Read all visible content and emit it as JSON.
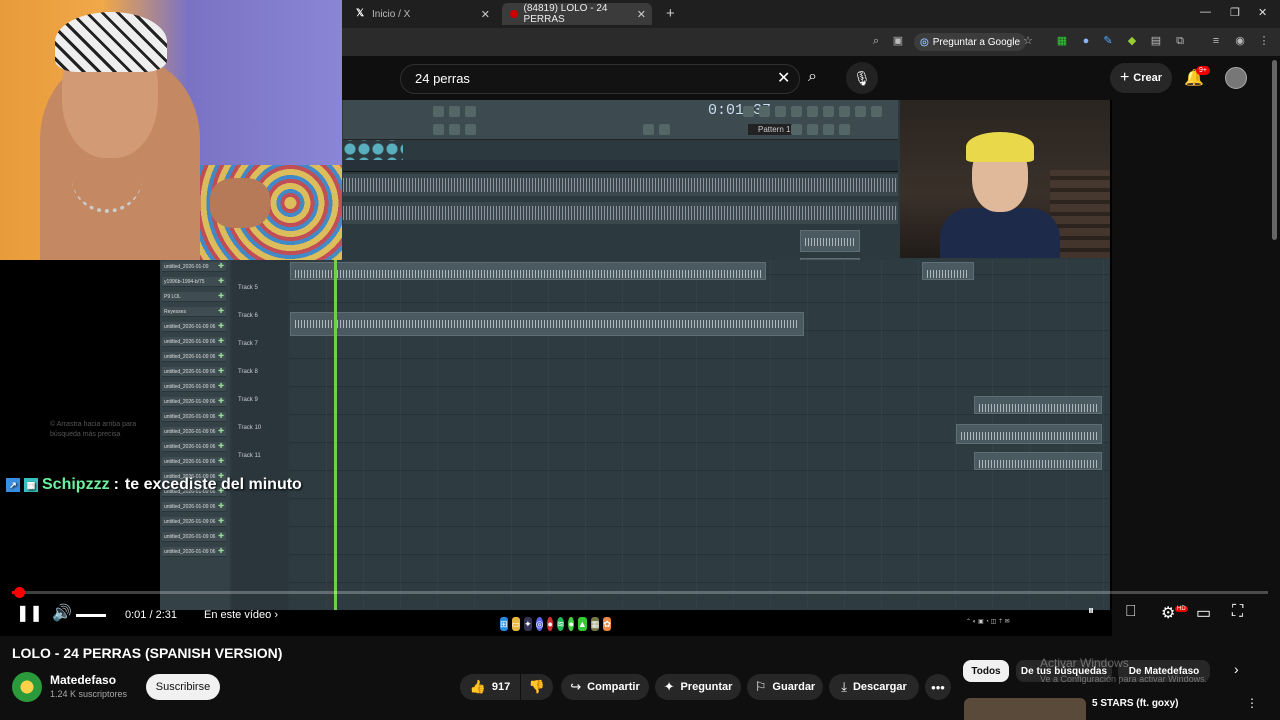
{
  "browser": {
    "tabs": [
      {
        "label": "Inicio / X",
        "icon": "x-logo-icon"
      },
      {
        "label": "(84819) LOLO - 24 PERRAS",
        "icon": "youtube-icon"
      }
    ],
    "ask_google": "Preguntar a Google"
  },
  "youtube": {
    "search_query": "24 perras",
    "create_label": "Crear",
    "notifications": "9+"
  },
  "video": {
    "chat_user": "Schipzzz",
    "chat_separator": ":",
    "chat_text": "te excediste del minuto",
    "ghost_text": "© Arrastra hacia arriba para búsqueda más precisa",
    "fl_time": "0:01:37",
    "fl_pattern": "Pattern 1",
    "track_names": [
      "Track 5",
      "Track 6",
      "Track 7",
      "Track 8",
      "Track 9",
      "Track 10",
      "Track 11"
    ],
    "left_items": [
      "untitled_2026-01-09",
      "y1996b-1994-b/75",
      "P9 LOL",
      "Reyesses",
      "untitled_2026-01-09 06",
      "untitled_2026-01-09 06",
      "untitled_2026-01-09 06",
      "untitled_2026-01-09 06",
      "untitled_2026-01-09 06",
      "untitled_2026-01-09 06",
      "untitled_2026-01-09 06",
      "untitled_2026-01-09 06",
      "untitled_2026-01-09 06",
      "untitled_2026-01-09 06",
      "untitled_2026-01-09 06",
      "untitled_2026-01-09 06",
      "untitled_2026-01-09 06",
      "untitled_2026-01-09 06",
      "untitled_2026-01-09 06",
      "untitled_2026-01-09 06"
    ],
    "progress_fraction": 0.0066
  },
  "player": {
    "time": "0:01 / 2:31",
    "chapter": "En este vídeo"
  },
  "details": {
    "title": "LOLO - 24 PERRAS (SPANISH VERSION)",
    "channel": "Matedefaso",
    "subscribers": "1.24 K suscriptores",
    "subscribe": "Suscribirse",
    "likes": "917",
    "share": "Compartir",
    "ask": "Preguntar",
    "save": "Guardar",
    "download": "Descargar"
  },
  "chips": [
    "Todos",
    "De tus búsquedas",
    "De Matedefaso"
  ],
  "watermark": {
    "line1": "Activar Windows",
    "line2": "Ve a Configuración para activar Windows."
  },
  "recommended": {
    "title": "5 STARS (ft. goxy)"
  }
}
